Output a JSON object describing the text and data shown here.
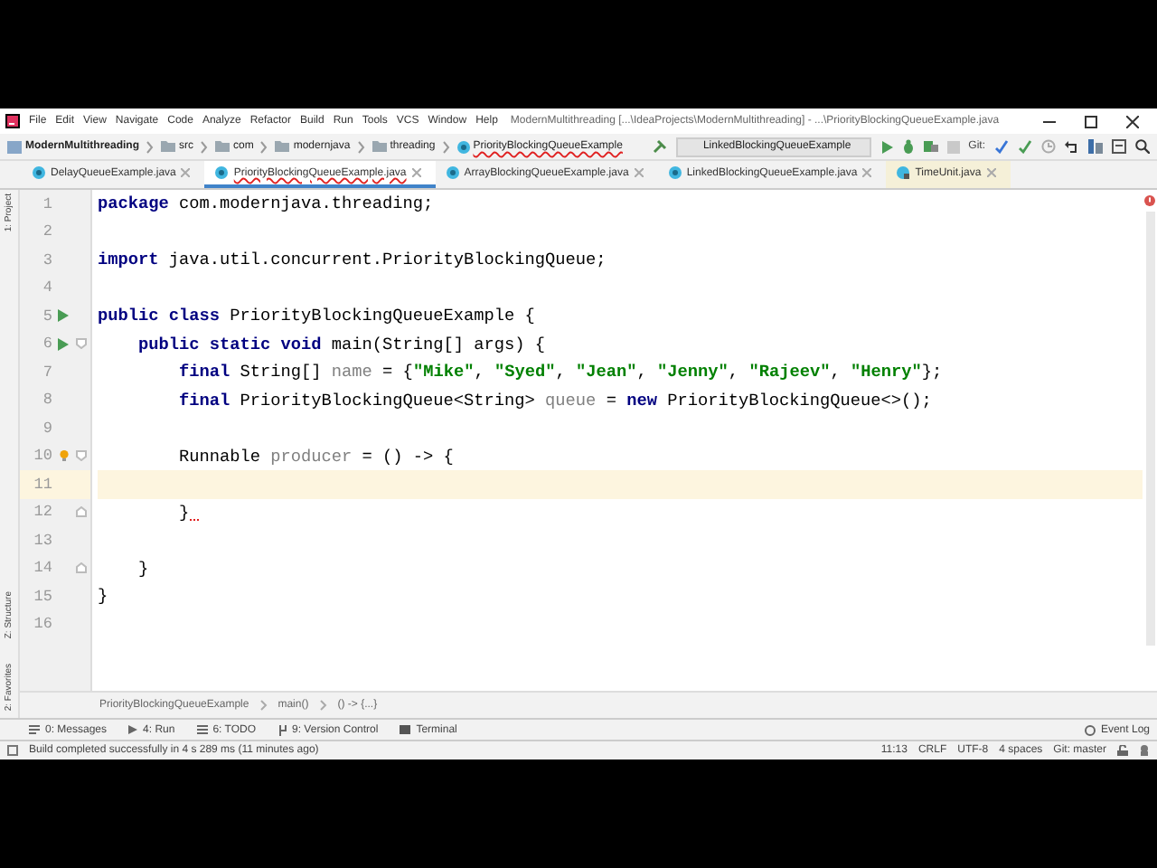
{
  "menu": {
    "items": [
      "File",
      "Edit",
      "View",
      "Navigate",
      "Code",
      "Analyze",
      "Refactor",
      "Build",
      "Run",
      "Tools",
      "VCS",
      "Window",
      "Help"
    ]
  },
  "window": {
    "title": "ModernMultithreading [...\\IdeaProjects\\ModernMultithreading] - ...\\PriorityBlockingQueueExample.java"
  },
  "navigation": {
    "path": [
      {
        "label": "ModernMultithreading",
        "kind": "project",
        "error": false
      },
      {
        "label": "src",
        "kind": "folder",
        "error": false
      },
      {
        "label": "com",
        "kind": "folder",
        "error": false
      },
      {
        "label": "modernjava",
        "kind": "folder",
        "error": false
      },
      {
        "label": "threading",
        "kind": "folder",
        "error": false
      },
      {
        "label": "PriorityBlockingQueueExample",
        "kind": "class",
        "error": true
      }
    ],
    "run_config": "LinkedBlockingQueueExample",
    "vcs_label": "Git:"
  },
  "tabs": [
    {
      "label": "DelayQueueExample.java",
      "kind": "class",
      "selected": false,
      "error": false
    },
    {
      "label": "PriorityBlockingQueueExample.java",
      "kind": "class",
      "selected": true,
      "error": true
    },
    {
      "label": "ArrayBlockingQueueExample.java",
      "kind": "class",
      "selected": false,
      "error": false
    },
    {
      "label": "LinkedBlockingQueueExample.java",
      "kind": "class",
      "selected": false,
      "error": false
    },
    {
      "label": "TimeUnit.java",
      "kind": "library",
      "selected": false,
      "error": false
    }
  ],
  "tool_strip_left": {
    "top": [
      "1: Project"
    ],
    "bottom": [
      "Z: Structure",
      "2: Favorites"
    ]
  },
  "editor": {
    "lines": [
      {
        "number": "1",
        "current": false,
        "error": false,
        "segments": [
          {
            "kind": "kw",
            "text": "package"
          },
          {
            "kind": "plain",
            "text": " com.modernjava.threading;"
          }
        ]
      },
      {
        "number": "2",
        "current": false
      },
      {
        "number": "3",
        "current": false,
        "error": false,
        "segments": [
          {
            "kind": "kw",
            "text": "import"
          },
          {
            "kind": "plain",
            "text": " java.util.concurrent.PriorityBlockingQueue;"
          }
        ]
      },
      {
        "number": "4",
        "current": false
      },
      {
        "number": "5",
        "markers": [
          {
            "kind": "run"
          }
        ],
        "current": false,
        "error": false,
        "segments": [
          {
            "kind": "kw",
            "text": "public class"
          },
          {
            "kind": "plain",
            "text": " PriorityBlockingQueueExample {"
          }
        ]
      },
      {
        "number": "6",
        "markers": [
          {
            "kind": "run"
          },
          {
            "kind": "fold_open"
          }
        ],
        "current": false,
        "error": false,
        "segments": [
          {
            "kind": "kw",
            "text": "    public static void"
          },
          {
            "kind": "plain",
            "text": " main(String[] args) {"
          }
        ]
      },
      {
        "number": "7",
        "current": false,
        "error": false,
        "segments": [
          {
            "kind": "kw",
            "text": "        final"
          },
          {
            "kind": "plain",
            "text": " String[] "
          },
          {
            "kind": "unused",
            "text": "name"
          },
          {
            "kind": "plain",
            "text": " = {"
          },
          {
            "kind": "str",
            "text": "\"Mike\""
          },
          {
            "kind": "plain",
            "text": ", "
          },
          {
            "kind": "str",
            "text": "\"Syed\""
          },
          {
            "kind": "plain",
            "text": ", "
          },
          {
            "kind": "str",
            "text": "\"Jean\""
          },
          {
            "kind": "plain",
            "text": ", "
          },
          {
            "kind": "str",
            "text": "\"Jenny\""
          },
          {
            "kind": "plain",
            "text": ", "
          },
          {
            "kind": "str",
            "text": "\"Rajeev\""
          },
          {
            "kind": "plain",
            "text": ", "
          },
          {
            "kind": "str",
            "text": "\"Henry\""
          },
          {
            "kind": "plain",
            "text": "};"
          }
        ]
      },
      {
        "number": "8",
        "current": false,
        "error": false,
        "segments": [
          {
            "kind": "kw",
            "text": "        final"
          },
          {
            "kind": "plain",
            "text": " PriorityBlockingQueue<String> "
          },
          {
            "kind": "unused",
            "text": "queue"
          },
          {
            "kind": "plain",
            "text": " = "
          },
          {
            "kind": "kw",
            "text": "new"
          },
          {
            "kind": "plain",
            "text": " PriorityBlockingQueue<>();"
          }
        ]
      },
      {
        "number": "9",
        "current": false
      },
      {
        "number": "10",
        "markers": [
          {
            "kind": "fold_open"
          },
          {
            "kind": "bulb"
          }
        ],
        "current": false,
        "error": false,
        "segments": [
          {
            "kind": "plain",
            "text": "        Runnable "
          },
          {
            "kind": "unused",
            "text": "producer"
          },
          {
            "kind": "plain",
            "text": " = () -> {"
          }
        ]
      },
      {
        "number": "11",
        "current": true
      },
      {
        "number": "12",
        "markers": [
          {
            "kind": "fold_close"
          }
        ],
        "current": false,
        "error": true,
        "segments": [
          {
            "kind": "plain",
            "text": "        }"
          }
        ]
      },
      {
        "number": "13",
        "current": false
      },
      {
        "number": "14",
        "markers": [
          {
            "kind": "fold_close"
          }
        ],
        "current": false,
        "error": false,
        "segments": [
          {
            "kind": "plain",
            "text": "    }"
          }
        ]
      },
      {
        "number": "15",
        "current": false,
        "error": false,
        "segments": [
          {
            "kind": "plain",
            "text": "}"
          }
        ]
      },
      {
        "number": "16",
        "current": false
      }
    ]
  },
  "breadcrumb": [
    "PriorityBlockingQueueExample",
    "main()",
    "() -> {...}"
  ],
  "tool_windows": [
    {
      "label": "0: Messages",
      "kind": "messages"
    },
    {
      "label": "4: Run",
      "kind": "run"
    },
    {
      "label": "6: TODO",
      "kind": "todo"
    },
    {
      "label": "9: Version Control",
      "kind": "vcs"
    },
    {
      "label": "Terminal",
      "kind": "terminal"
    }
  ],
  "event_log": "Event Log",
  "status_bar": {
    "message": "Build completed successfully in 4 s 289 ms (11 minutes ago)",
    "items": [
      "11:13",
      "CRLF",
      "UTF-8",
      "4 spaces",
      "Git: master"
    ]
  }
}
